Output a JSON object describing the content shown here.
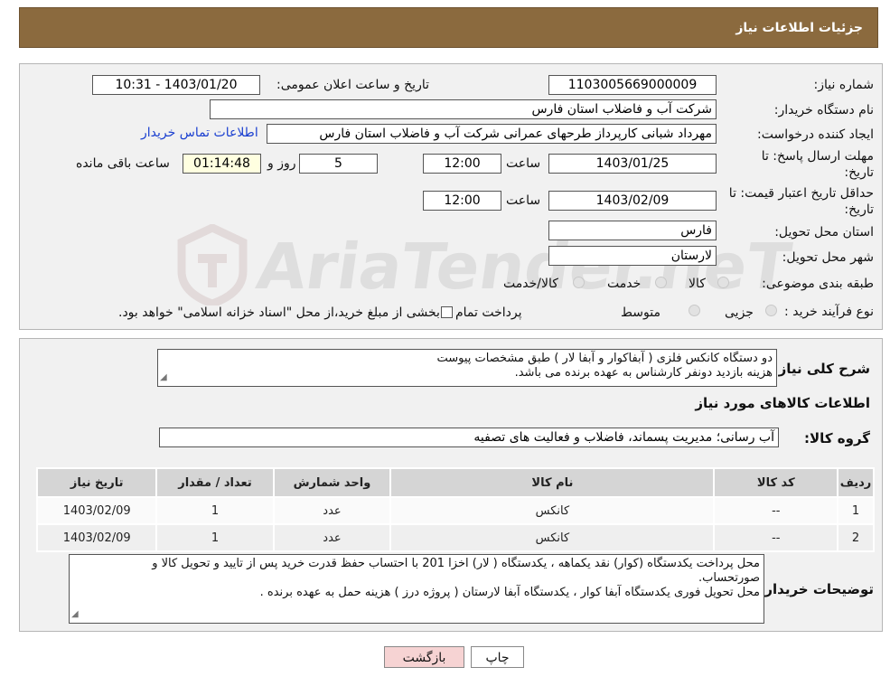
{
  "header": {
    "title": "جزئیات اطلاعات نیاز"
  },
  "info": {
    "need_number_label": "شماره نیاز:",
    "need_number": "1103005669000009",
    "announce_label": "تاریخ و ساعت اعلان عمومی:",
    "announce_value": "1403/01/20 - 10:31",
    "buyer_org_label": "نام دستگاه خریدار:",
    "buyer_org": "شرکت آب و فاضلاب استان فارس",
    "requester_label": "ایجاد کننده درخواست:",
    "requester": "مهرداد شبانی کارپرداز طرحهای عمرانی  شرکت آب و فاضلاب استان فارس",
    "contact_link": "اطلاعات تماس خریدار",
    "deadline_label_1": "مهلت ارسال پاسخ: تا",
    "deadline_label_2": "تاریخ:",
    "deadline_date": "1403/01/25",
    "time_label": "ساعت",
    "deadline_time": "12:00",
    "days_value": "5",
    "days_label": "روز و",
    "remaining_value": "01:14:48",
    "remaining_label": "ساعت باقی مانده",
    "validity_label_1": "حداقل تاریخ اعتبار قیمت: تا",
    "validity_label_2": "تاریخ:",
    "validity_date": "1403/02/09",
    "validity_time": "12:00",
    "province_label": "استان محل تحویل:",
    "province": "فارس",
    "city_label": "شهر محل تحویل:",
    "city": "لارستان",
    "category_label": "طبقه بندی موضوعی:",
    "category_options": [
      "کالا",
      "خدمت",
      "کالا/خدمت"
    ],
    "process_label": "نوع فرآیند خرید :",
    "process_options": [
      "جزیی",
      "متوسط"
    ],
    "process_note": "پرداخت تمام یا بخشی از مبلغ خرید،از محل \"اسناد خزانه اسلامی\" خواهد بود."
  },
  "description": {
    "label": "شرح کلی نیاز:",
    "line1": "دو دستگاه کانکس فلزی ( آبفاکوار و آبفا لار )  طبق مشخصات پیوست",
    "line2": "هزینه بازدید دونفر کارشناس به عهده برنده می باشد."
  },
  "goods": {
    "title": "اطلاعات کالاهای مورد نیاز",
    "group_label": "گروه کالا:",
    "group_value": "آب رسانی؛ مدیریت پسماند، فاضلاب و فعالیت های تصفیه",
    "columns": [
      "ردیف",
      "کد کالا",
      "نام کالا",
      "واحد شمارش",
      "تعداد / مقدار",
      "تاریخ نیاز"
    ],
    "rows": [
      [
        "1",
        "--",
        "کانکس",
        "عدد",
        "1",
        "1403/02/09"
      ],
      [
        "2",
        "--",
        "کانکس",
        "عدد",
        "1",
        "1403/02/09"
      ]
    ]
  },
  "buyer_notes": {
    "label": "توضیحات خریدار:",
    "line1": "محل پرداخت یکدستگاه (کوار) نقد یکماهه ، یکدستگاه ( لار) اخزا 201 با احتساب حفظ قدرت خرید پس از تایید و تحویل کالا و",
    "line2": "صورتحساب.",
    "line3": "محل تحویل فوری یکدستگاه آبفا کوار ، یکدستگاه آبفا لارستان ( پروژه درز ) هزینه حمل به عهده برنده ."
  },
  "buttons": {
    "print": "چاپ",
    "back": "بازگشت"
  },
  "colors": {
    "header": "#8b6a3e",
    "link": "#1a3fd0",
    "back_button": "#f6d3d3"
  },
  "watermark": {
    "text": "AriaTender.neT"
  }
}
